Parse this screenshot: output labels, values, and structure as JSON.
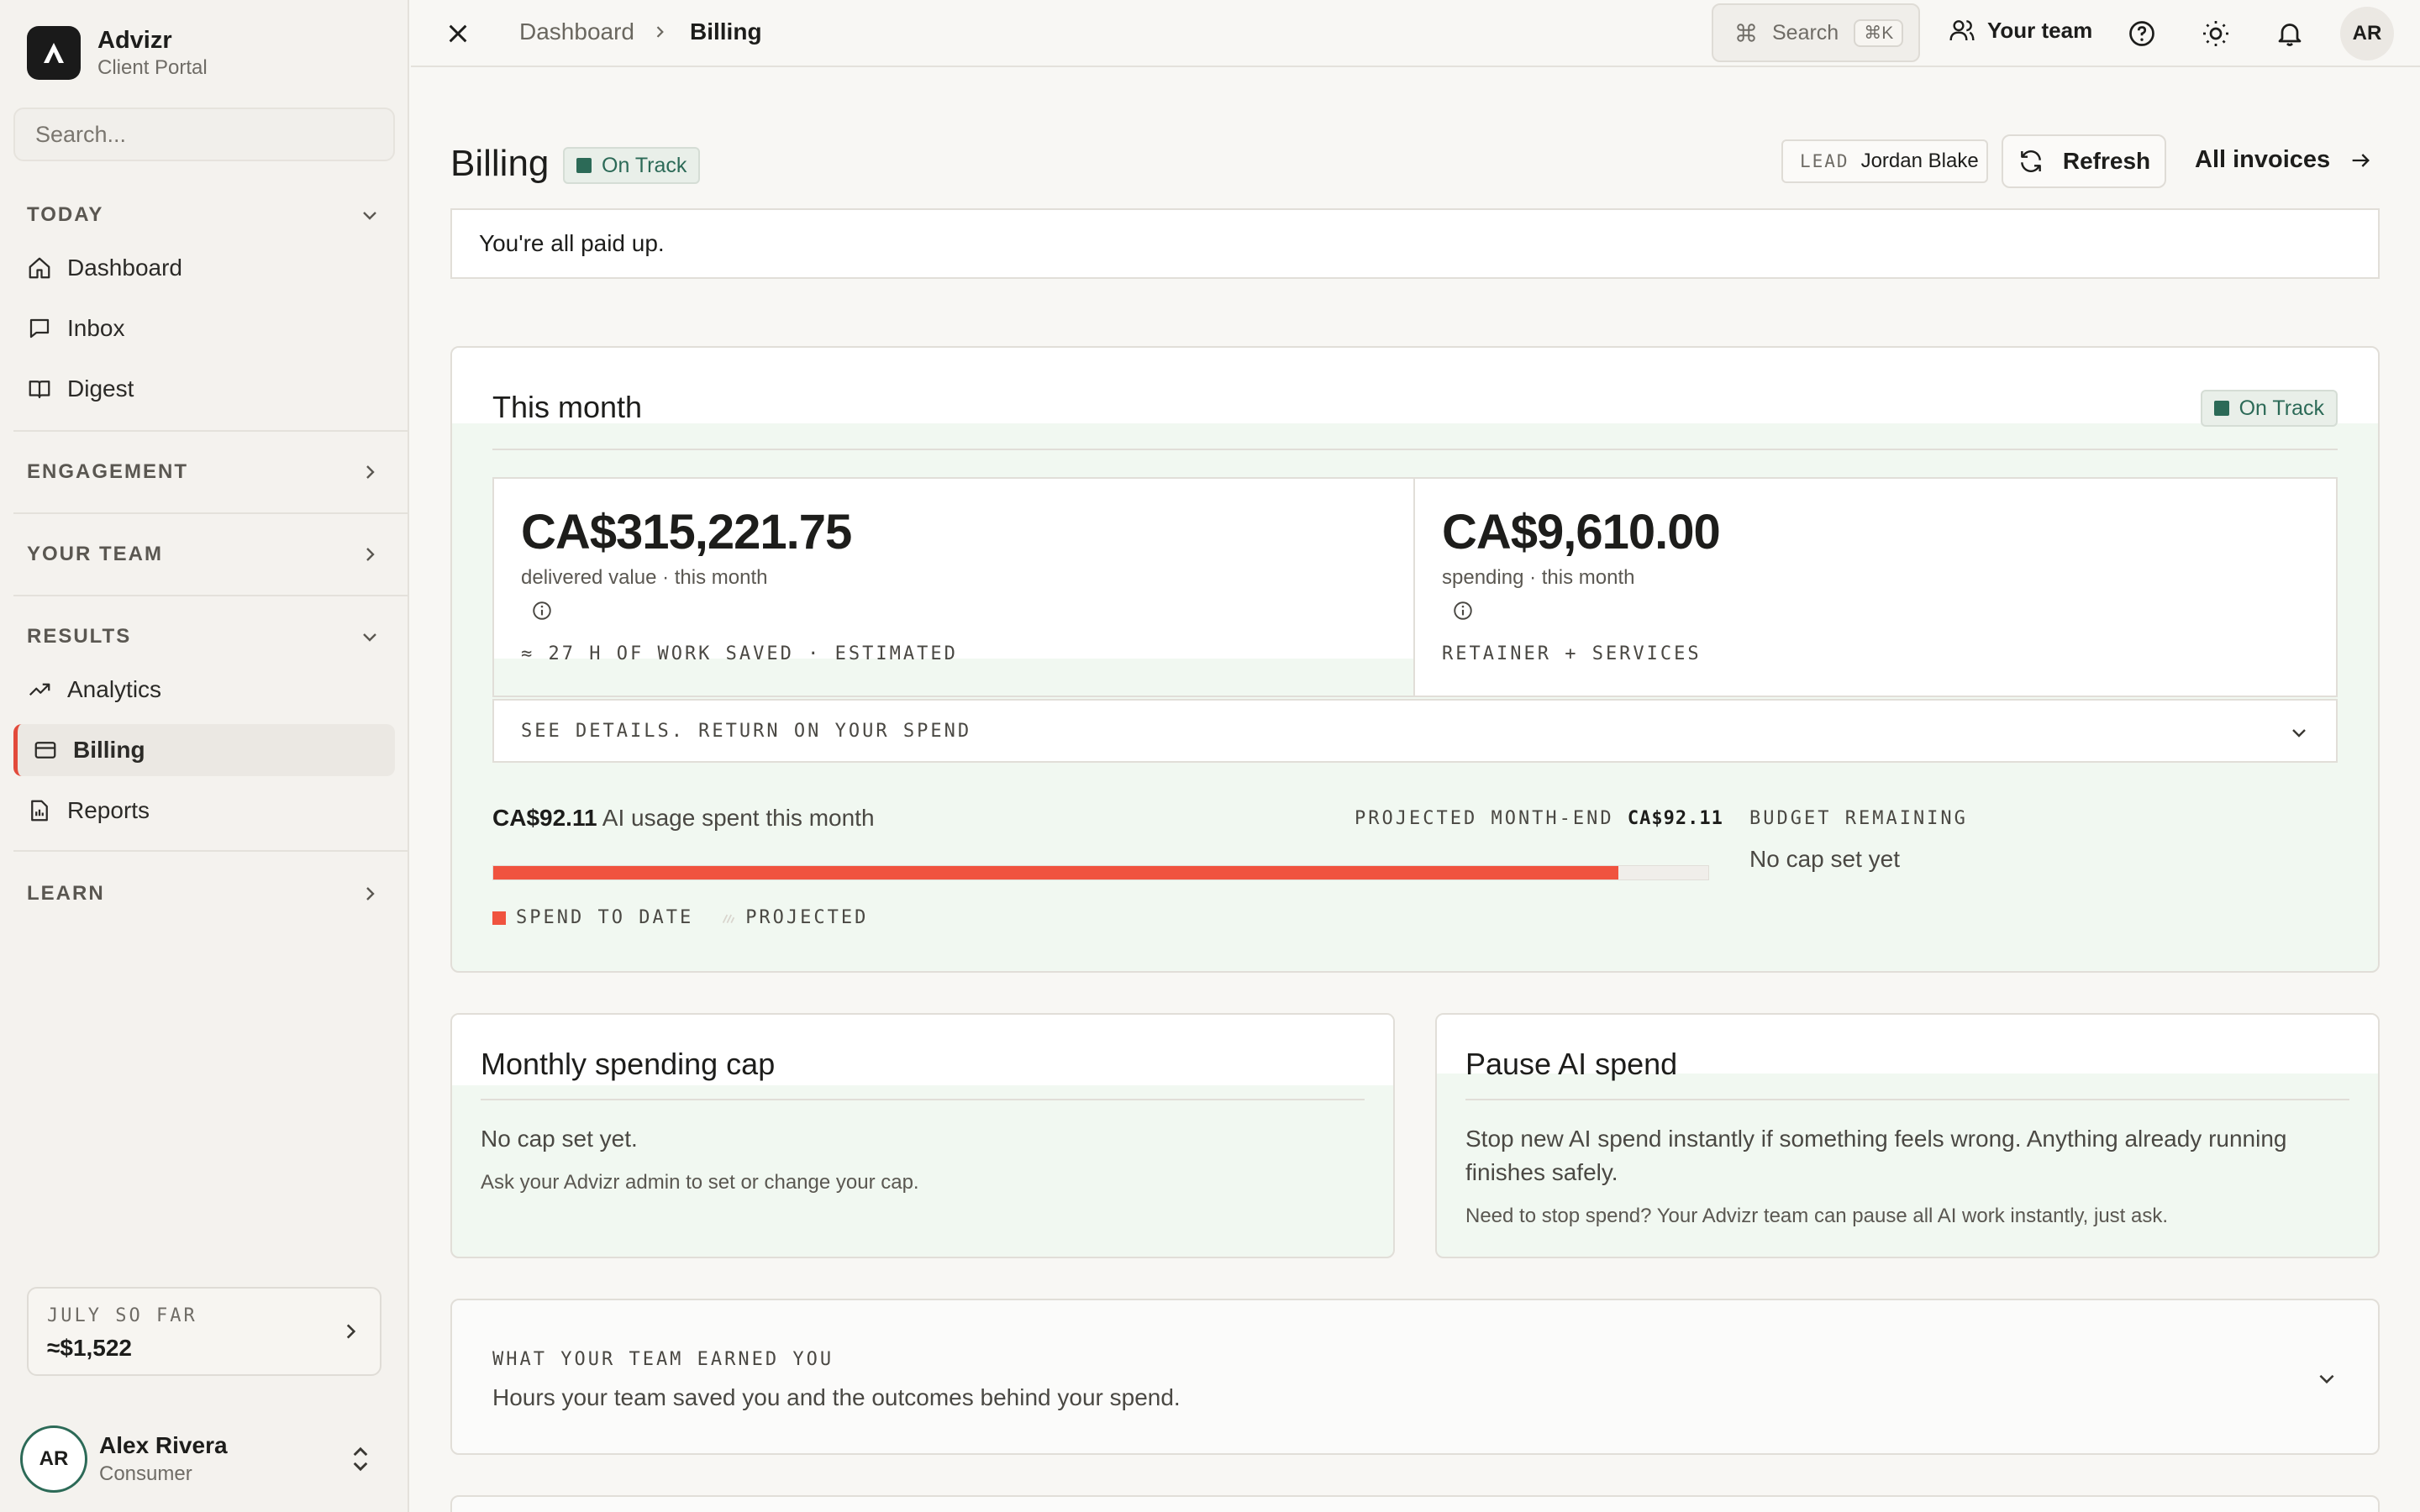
{
  "brand": {
    "name": "Advizr",
    "subtitle": "Client Portal"
  },
  "sidebar": {
    "search_placeholder": "Search...",
    "sections": {
      "today": "TODAY",
      "engagement": "ENGAGEMENT",
      "your_team": "YOUR TEAM",
      "results": "RESULTS",
      "learn": "LEARN"
    },
    "items": {
      "dashboard": "Dashboard",
      "inbox": "Inbox",
      "digest": "Digest",
      "analytics": "Analytics",
      "billing": "Billing",
      "reports": "Reports"
    },
    "summary": {
      "label": "JULY SO FAR",
      "value": "≈$1,522"
    },
    "user": {
      "initials": "AR",
      "name": "Alex Rivera",
      "role": "Consumer"
    }
  },
  "topbar": {
    "breadcrumb": [
      "Dashboard",
      "Billing"
    ],
    "search_label": "Search",
    "search_shortcut": "⌘K",
    "team_label": "Your team",
    "avatar_initials": "AR"
  },
  "header": {
    "title": "Billing",
    "status": "On Track",
    "lead_label": "LEAD",
    "lead_name": "Jordan Blake",
    "refresh_label": "Refresh",
    "invoices_label": "All invoices"
  },
  "notice": "You're all paid up.",
  "this_month": {
    "title": "This month",
    "status": "On Track",
    "delivered": {
      "value": "CA$315,221.75",
      "label": "delivered value · this month",
      "foot": "≈ 27 H OF WORK SAVED · ESTIMATED"
    },
    "spending": {
      "value": "CA$9,610.00",
      "label": "spending · this month",
      "foot": "RETAINER + SERVICES"
    },
    "details_label": "SEE DETAILS. RETURN ON YOUR SPEND",
    "ai_amount": "CA$92.11",
    "ai_text": "AI usage spent this month",
    "projected_label": "PROJECTED MONTH-END",
    "projected_value": "CA$92.11",
    "spend_fraction": 0.926,
    "legend_spend": "SPEND TO DATE",
    "legend_projected": "PROJECTED",
    "budget_label": "BUDGET REMAINING",
    "budget_value": "No cap set yet",
    "colors": {
      "spend": "#f0533f",
      "accent": "#2c6a57"
    }
  },
  "cap_card": {
    "title": "Monthly spending cap",
    "text": "No cap set yet.",
    "note": "Ask your Advizr admin to set or change your cap."
  },
  "pause_card": {
    "title": "Pause AI spend",
    "text": "Stop new AI spend instantly if something feels wrong. Anything already running finishes safely.",
    "note": "Need to stop spend? Your Advizr team can pause all AI work instantly, just ask."
  },
  "earned": {
    "label": "WHAT YOUR TEAM EARNED YOU",
    "text": "Hours your team saved you and the outcomes behind your spend."
  }
}
